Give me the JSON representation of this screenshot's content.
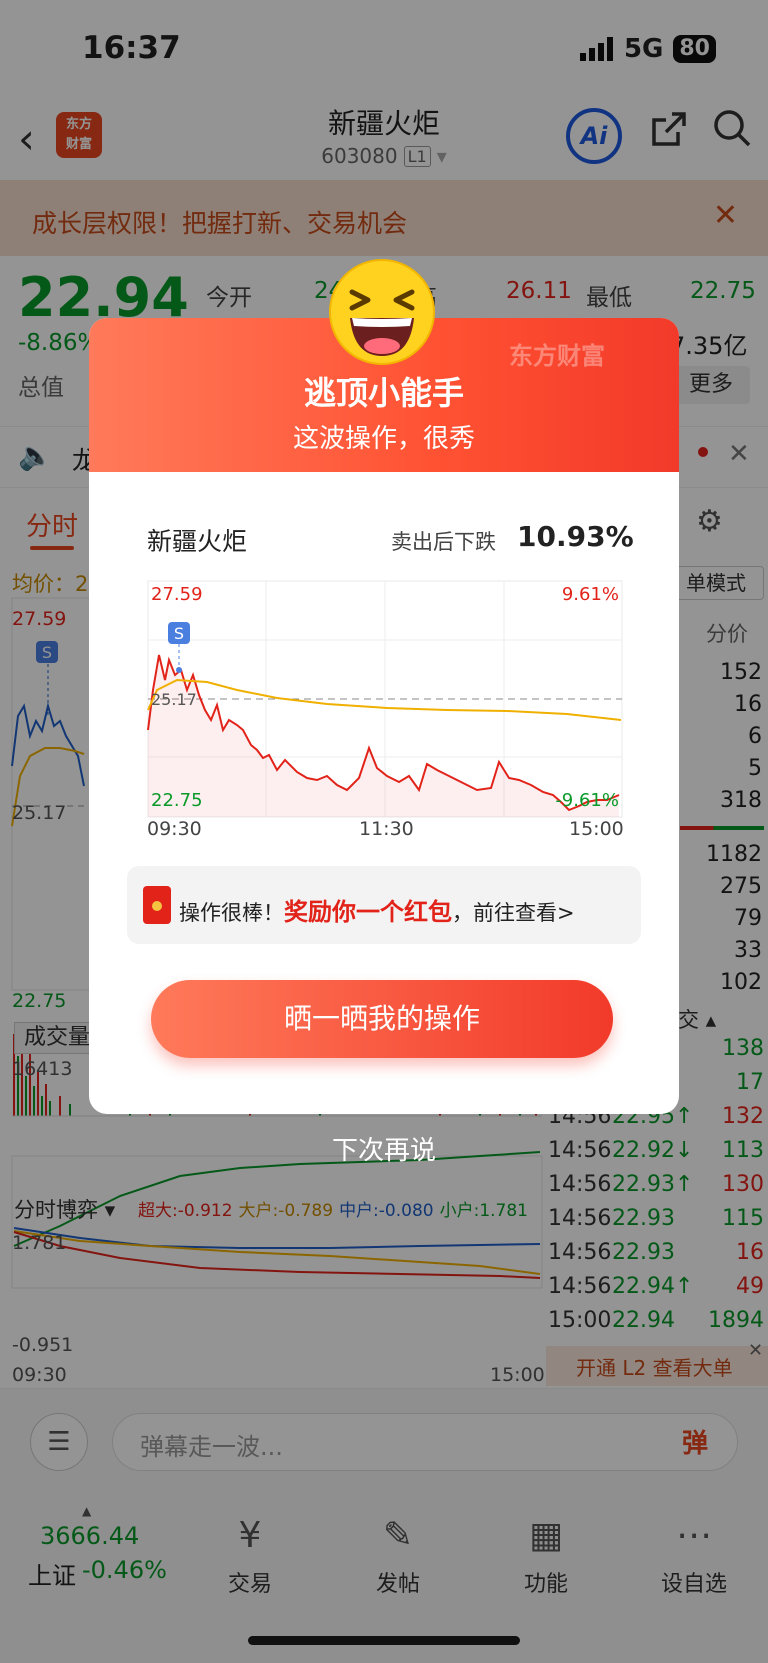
{
  "status": {
    "time": "16:37",
    "network": "5G",
    "battery": "80"
  },
  "header": {
    "title": "新疆火炬",
    "code": "603080",
    "level": "L1",
    "logo_line1": "东方",
    "logo_line2": "财富",
    "ai_label": "Ai"
  },
  "banner": {
    "text": "成长层权限！把握打新、交易机会"
  },
  "quote": {
    "price": "22.94",
    "change_pct": "-8.86%",
    "zongzhi_label": "总值",
    "open_label": "今开",
    "open_value": "24",
    "high_label": "高",
    "high_value": "26.11",
    "low_label": "最低",
    "low_value": "22.75",
    "amount_value": "7.35亿",
    "more_label": "更多"
  },
  "announce": {
    "text": "龙"
  },
  "tabs": {
    "fenshi": "分时"
  },
  "chart_bg": {
    "avg_label": "均价：2",
    "mode_label": "单模式",
    "price_col_label": "分价",
    "top_price": "27.59",
    "mid_price": "25.17",
    "bottom_price": "22.75",
    "signal": "S",
    "volume_tab": "成交量",
    "volume_max": "16413",
    "game_label": "分时博弈 ▾",
    "game_values": {
      "super": "超大:-0.912",
      "big": "大户:-0.789",
      "mid": "中户:-0.080",
      "small": "小户:1.781"
    },
    "game_max": "1.781",
    "game_min": "-0.951",
    "time_start": "09:30",
    "time_end": "15:00"
  },
  "orderbook": [
    "152",
    "16",
    "6",
    "5",
    "318",
    "1182",
    "275",
    "79",
    "33",
    "102"
  ],
  "trade_header": "交 ▴",
  "trades": [
    {
      "time": "",
      "price": "",
      "vol": "138",
      "dir": ""
    },
    {
      "time": "",
      "price": "↓",
      "vol": "17",
      "dir": ""
    },
    {
      "time": "14:56",
      "price": "22.95↑",
      "vol": "132",
      "dir": "up"
    },
    {
      "time": "14:56",
      "price": "22.92↓",
      "vol": "113",
      "dir": "down"
    },
    {
      "time": "14:56",
      "price": "22.93↑",
      "vol": "130",
      "dir": "up"
    },
    {
      "time": "14:56",
      "price": "22.93",
      "vol": "115",
      "dir": "flat"
    },
    {
      "time": "14:56",
      "price": "22.93",
      "vol": "16",
      "dir": "flat"
    },
    {
      "time": "14:56",
      "price": "22.94↑",
      "vol": "49",
      "dir": "up"
    },
    {
      "time": "15:00",
      "price": "22.94",
      "vol": "1894",
      "dir": "flat"
    }
  ],
  "l2_bar": {
    "text": "开通 L2 查看大单"
  },
  "comment": {
    "placeholder": "弹幕走一波...",
    "send": "弹"
  },
  "bottom_nav": {
    "index_value": "3666.44",
    "index_name": "上证",
    "index_change": "-0.46%",
    "items": [
      {
        "label": "交易",
        "icon": "yen-exchange-icon"
      },
      {
        "label": "发帖",
        "icon": "edit-icon"
      },
      {
        "label": "功能",
        "icon": "grid-icon"
      },
      {
        "label": "设自选",
        "icon": "more-icon"
      }
    ]
  },
  "modal": {
    "watermark": "东方财富",
    "title": "逃顶小能手",
    "subtitle": "这波操作，很秀",
    "stock_name": "新疆火炬",
    "after_sell_label": "卖出后下跌",
    "after_sell_value": "10.93%",
    "chart": {
      "top_left": "27.59",
      "top_right": "9.61%",
      "bottom_left": "22.75",
      "bottom_right": "-9.61%",
      "mid": "25.17",
      "signal": "S",
      "times": [
        "09:30",
        "11:30",
        "15:00"
      ]
    },
    "reward_prefix": "操作很棒！",
    "reward_highlight": "奖励你一个红包",
    "reward_suffix": "，前往查看>",
    "share_button": "晒一晒我的操作",
    "dismiss": "下次再说"
  },
  "colors": {
    "accent": "#e8471f",
    "up": "#e2231a",
    "down": "#0a9a2a",
    "avg": "#f0b000"
  }
}
